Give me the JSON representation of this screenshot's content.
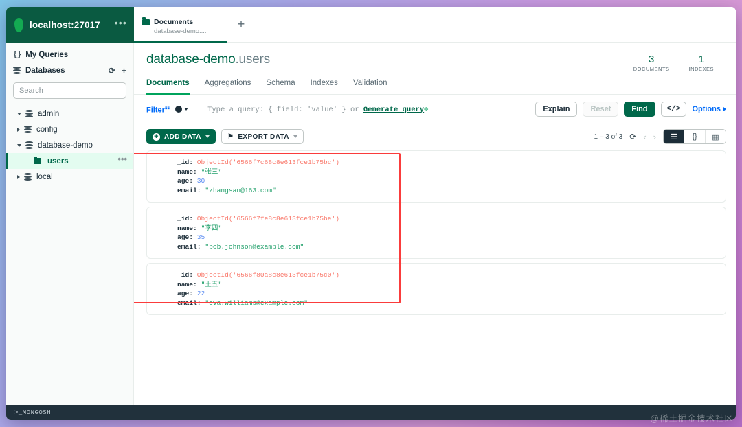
{
  "connection": {
    "name": "localhost:27017",
    "menu_icon": "ellipsis-icon",
    "logo_icon": "mongodb-leaf-icon"
  },
  "tabs": {
    "open": [
      {
        "title": "Documents",
        "subtitle": "database-demo....",
        "icon": "folder-icon"
      }
    ],
    "new_tab_label": "+"
  },
  "sidebar": {
    "my_queries": {
      "label": "My Queries",
      "icon": "braces-icon"
    },
    "databases": {
      "label": "Databases",
      "icon": "database-icon",
      "refresh_icon": "refresh-icon",
      "add_icon": "plus-icon"
    },
    "search": {
      "placeholder": "Search",
      "value": ""
    },
    "tree": [
      {
        "label": "admin",
        "type": "database",
        "expanded": true
      },
      {
        "label": "config",
        "type": "database",
        "expanded": false
      },
      {
        "label": "database-demo",
        "type": "database",
        "expanded": true
      },
      {
        "label": "users",
        "type": "collection",
        "selected": true,
        "menu_icon": "ellipsis-icon"
      },
      {
        "label": "local",
        "type": "database",
        "expanded": false
      }
    ]
  },
  "collection": {
    "database": "database-demo",
    "name": ".users",
    "stats": [
      {
        "value": "3",
        "label": "DOCUMENTS"
      },
      {
        "value": "1",
        "label": "INDEXES"
      }
    ],
    "tabs": [
      {
        "label": "Documents",
        "active": true
      },
      {
        "label": "Aggregations",
        "active": false
      },
      {
        "label": "Schema",
        "active": false
      },
      {
        "label": "Indexes",
        "active": false
      },
      {
        "label": "Validation",
        "active": false
      }
    ]
  },
  "query_bar": {
    "filter_label": "Filter",
    "filter_external_icon": "external-link-icon",
    "history_icon": "clock-icon",
    "history_caret_icon": "chevron-down-icon",
    "placeholder_prefix": "Type a query: { field: 'value' } or ",
    "generate_query_label": "Generate query",
    "sparkle_icon": "sparkle-icon",
    "explain_label": "Explain",
    "reset_label": "Reset",
    "find_label": "Find",
    "code_icon": "</>",
    "options_label": "Options",
    "options_caret_icon": "chevron-right-icon"
  },
  "toolbar": {
    "add_data_label": "ADD DATA",
    "add_data_icon": "plus-circle-icon",
    "export_data_label": "EXPORT DATA",
    "export_data_icon": "export-icon",
    "caret_icon": "chevron-down-icon",
    "range_label": "1 – 3 of 3",
    "refresh_icon": "refresh-icon",
    "prev_icon": "chevron-left-icon",
    "next_icon": "chevron-right-icon",
    "views": [
      {
        "name": "list-view",
        "icon": "☰",
        "active": true
      },
      {
        "name": "json-view",
        "icon": "{}",
        "active": false
      },
      {
        "name": "table-view",
        "icon": "▦",
        "active": false
      }
    ]
  },
  "documents": [
    {
      "_id_key": "_id:",
      "_id_value": "ObjectId('6566f7c68c8e613fce1b75bc')",
      "name_key": "name:",
      "name_value": "\"张三\"",
      "age_key": "age:",
      "age_value": "30",
      "email_key": "email:",
      "email_value": "\"zhangsan@163.com\""
    },
    {
      "_id_key": "_id:",
      "_id_value": "ObjectId('6566f7fe8c8e613fce1b75be')",
      "name_key": "name:",
      "name_value": "\"李四\"",
      "age_key": "age:",
      "age_value": "35",
      "email_key": "email:",
      "email_value": "\"bob.johnson@example.com\""
    },
    {
      "_id_key": "_id:",
      "_id_value": "ObjectId('6566f80a8c8e613fce1b75c0')",
      "name_key": "name:",
      "name_value": "\"王五\"",
      "age_key": "age:",
      "age_value": "22",
      "email_key": "email:",
      "email_value": "\"eva.williams@example.com\""
    }
  ],
  "annotation": {
    "color": "#fa3c3c"
  },
  "status_bar": {
    "mongosh_label": ">_MONGOSH"
  },
  "watermark": {
    "text": "@稀土掘金技术社区"
  },
  "colors": {
    "brand_dark_green": "#0a5a41",
    "brand_green": "#00684a",
    "accent_green": "#00a35c",
    "link_blue": "#016bf8",
    "status_bar": "#21313c",
    "string_green": "#22a06b",
    "objectid_red": "#f97a6d",
    "number_blue": "#5b8cf2"
  }
}
